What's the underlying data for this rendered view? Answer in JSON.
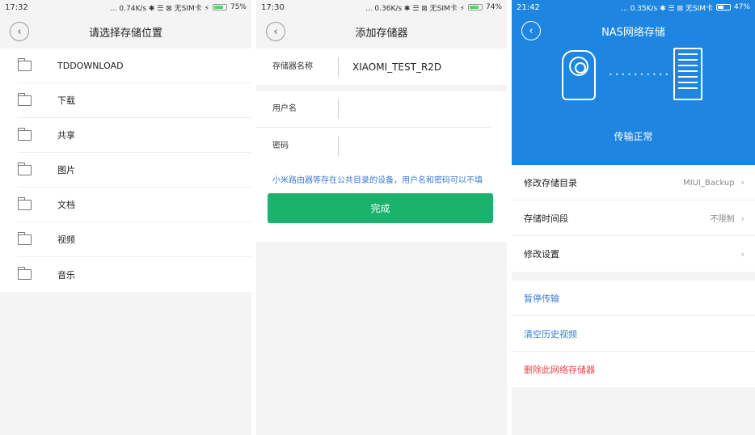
{
  "screen1": {
    "time": "17:32",
    "status_right": "... 0.74K/s ✱ ☰ ⊠ 无SIM卡 ⚡",
    "battery": "75%",
    "title": "请选择存储位置",
    "folders": [
      "TDDOWNLOAD",
      "下载",
      "共享",
      "图片",
      "文档",
      "视频",
      "音乐"
    ]
  },
  "screen2": {
    "time": "17:30",
    "status_right": "... 0.36K/s ✱ ☰ ⊠ 无SIM卡 ⚡",
    "battery": "74%",
    "title": "添加存储器",
    "device_label": "存储器名称",
    "device_value": "XIAOMI_TEST_R2D",
    "username_label": "用户名",
    "username_value": "",
    "password_label": "密码",
    "password_value": "",
    "hint": "小米路由器等存在公共目录的设备，用户名和密码可以不填",
    "done_label": "完成"
  },
  "screen3": {
    "time": "21:42",
    "status_right": "... 0.35K/s ✱ ☰ ⊠ 无SIM卡",
    "battery": "47%",
    "title": "NAS网络存储",
    "transfer_status": "传输正常",
    "rows": [
      {
        "label": "修改存储目录",
        "value": "MIUI_Backup"
      },
      {
        "label": "存储时间段",
        "value": "不限制"
      },
      {
        "label": "修改设置",
        "value": ""
      }
    ],
    "actions": [
      "暂停传输",
      "清空历史视频",
      "删除此网络存储器"
    ]
  },
  "colors": {
    "accent_green": "#1ab26c",
    "header_blue": "#1e86e0",
    "link_blue": "#3a7bd5",
    "danger_red": "#e64545"
  }
}
